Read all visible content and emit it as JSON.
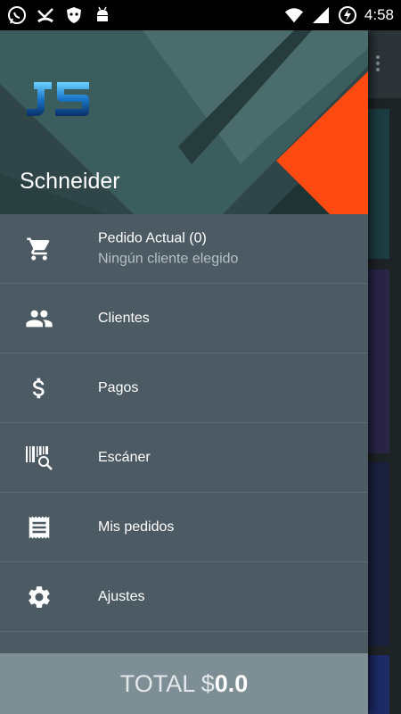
{
  "status_bar": {
    "time": "4:58",
    "left_icons": [
      "whatsapp-icon",
      "missed-call-icon",
      "shield-icon",
      "android-icon"
    ],
    "right_icons": [
      "wifi-icon",
      "cell-signal-icon",
      "battery-charging-icon"
    ]
  },
  "drawer": {
    "header": {
      "logo_text": "JS",
      "user_name": "Schneider",
      "accent_color": "#ff4a12"
    },
    "items": [
      {
        "label": "Pedido Actual (0)",
        "sublabel": "Ningún cliente elegido",
        "icon": "cart-icon"
      },
      {
        "label": "Clientes",
        "icon": "people-icon"
      },
      {
        "label": "Pagos",
        "icon": "dollar-icon"
      },
      {
        "label": "Escáner",
        "icon": "barcode-scan-icon"
      },
      {
        "label": "Mis pedidos",
        "icon": "receipt-icon"
      },
      {
        "label": "Ajustes",
        "icon": "settings-icon"
      }
    ],
    "total": {
      "label": "TOTAL $",
      "amount": "0.0"
    }
  },
  "colors": {
    "drawer_bg": "#4b5a63",
    "header_bg": "#2f4547",
    "total_bar": "#7d8e95",
    "accent": "#ff4a12"
  }
}
